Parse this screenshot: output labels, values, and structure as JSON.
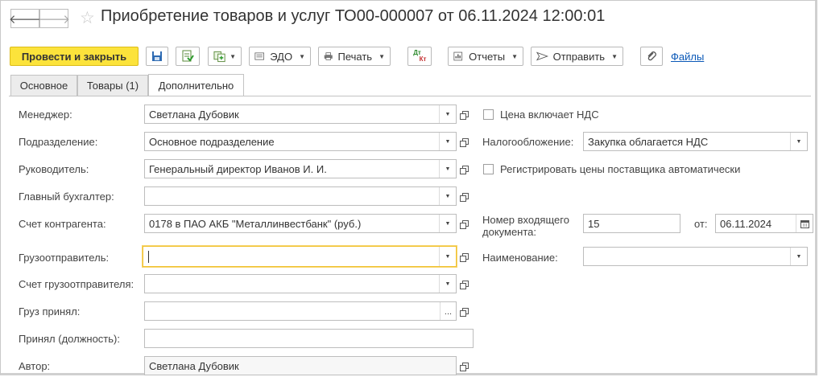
{
  "window": {
    "title": "Приобретение товаров и услуг ТО00-000007 от 06.11.2024 12:00:01"
  },
  "nav": {
    "back": "🡐",
    "forward": "🡒"
  },
  "toolbar": {
    "post_close": "Провести и закрыть",
    "edo": "ЭДО",
    "print": "Печать",
    "dt": "Дт",
    "kt": "Кт",
    "reports": "Отчеты",
    "send": "Отправить",
    "files": "Файлы"
  },
  "tabs": [
    {
      "label": "Основное"
    },
    {
      "label": "Товары (1)"
    },
    {
      "label": "Дополнительно"
    }
  ],
  "form": {
    "manager": {
      "label": "Менеджер:",
      "value": "Светлана Дубовик"
    },
    "department": {
      "label": "Подразделение:",
      "value": "Основное подразделение"
    },
    "head": {
      "label": "Руководитель:",
      "value": "Генеральный директор Иванов И. И."
    },
    "chief_accountant": {
      "label": "Главный бухгалтер:",
      "value": ""
    },
    "counterparty_account": {
      "label": "Счет контрагента:",
      "value": "0178 в ПАО АКБ \"Металлинвестбанк\" (руб.)"
    },
    "shipper": {
      "label": "Грузоотправитель:",
      "value": ""
    },
    "shipper_account": {
      "label": "Счет грузоотправителя:",
      "value": ""
    },
    "cargo_received": {
      "label": "Груз принял:",
      "value": ""
    },
    "received_position": {
      "label": "Принял (должность):",
      "value": ""
    },
    "author": {
      "label": "Автор:",
      "value": "Светлана Дубовик"
    },
    "price_includes_vat": {
      "label": "Цена включает НДС",
      "checked": false
    },
    "taxation": {
      "label": "Налогообложение:",
      "value": "Закупка облагается НДС"
    },
    "register_prices": {
      "label": "Регистрировать цены поставщика автоматически",
      "checked": false
    },
    "incoming_number": {
      "label_line1": "Номер входящего",
      "label_line2": "документа:",
      "value": "15"
    },
    "incoming_date": {
      "label": "от:",
      "value": "06.11.2024"
    },
    "name": {
      "label": "Наименование:",
      "value": ""
    }
  }
}
